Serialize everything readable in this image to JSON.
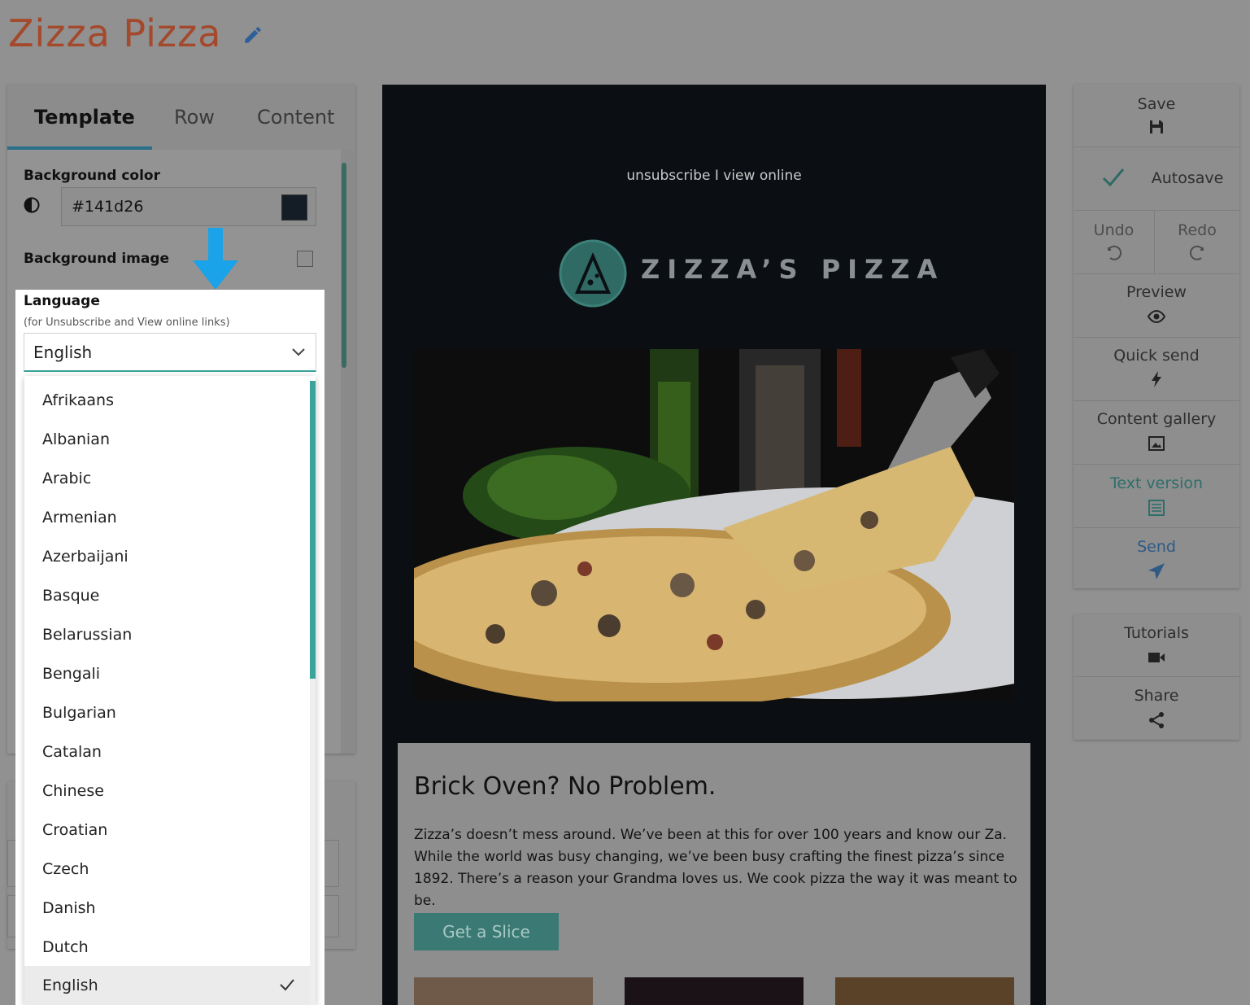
{
  "app": {
    "title": "Zizza Pizza"
  },
  "left_panel": {
    "tabs": [
      {
        "label": "Template"
      },
      {
        "label": "Row"
      },
      {
        "label": "Content"
      }
    ],
    "background_color": {
      "label": "Background color",
      "value": "#141d26"
    },
    "background_image": {
      "label": "Background image"
    },
    "language": {
      "label": "Language",
      "sublabel": "(for Unsubscribe and View online links)",
      "selected": "English",
      "options": [
        "Afrikaans",
        "Albanian",
        "Arabic",
        "Armenian",
        "Azerbaijani",
        "Basque",
        "Belarussian",
        "Bengali",
        "Bulgarian",
        "Catalan",
        "Chinese",
        "Croatian",
        "Czech",
        "Danish",
        "Dutch",
        "English"
      ]
    }
  },
  "email": {
    "links": "unsubscribe I view online",
    "logo_text": "ZIZZA’S PIZZA",
    "heading": "Brick Oven? No Problem.",
    "body": "Zizza’s doesn’t mess around. We’ve been at this for over 100 years and know our Za. While the world was busy changing, we’ve been busy crafting the finest pizza’s since 1892. There’s a reason your Grandma loves us. We cook pizza the way it was meant to be.",
    "cta": "Get a Slice"
  },
  "toolbar": {
    "save": "Save",
    "autosave": "Autosave",
    "undo": "Undo",
    "redo": "Redo",
    "preview": "Preview",
    "quick_send": "Quick send",
    "content_gallery": "Content gallery",
    "text_version": "Text version",
    "send": "Send",
    "tutorials": "Tutorials",
    "share": "Share"
  },
  "colors": {
    "accent": "#3aa39a",
    "title": "#a4492c",
    "email_bg": "#141d26",
    "highlight_arrow": "#1aa3e8"
  }
}
